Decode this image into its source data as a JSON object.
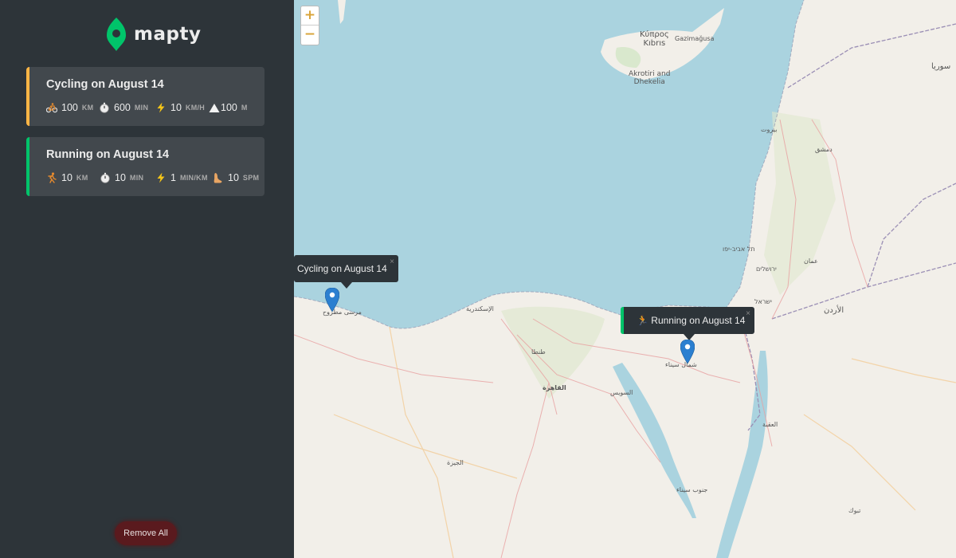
{
  "app": {
    "name": "mapty",
    "brand_color": "#00c46a"
  },
  "workouts": [
    {
      "type": "cycling",
      "title": "Cycling on August 14",
      "accent": "#ffb545",
      "details": [
        {
          "icon": "bicycle-icon",
          "value": "100",
          "unit": "KM"
        },
        {
          "icon": "stopwatch-icon",
          "value": "600",
          "unit": "MIN"
        },
        {
          "icon": "lightning-icon",
          "value": "10",
          "unit": "KM/H"
        },
        {
          "icon": "mountain-icon",
          "value": "100",
          "unit": "M"
        }
      ]
    },
    {
      "type": "running",
      "title": "Running on August 14",
      "accent": "#00c46a",
      "details": [
        {
          "icon": "runner-icon",
          "value": "10",
          "unit": "KM"
        },
        {
          "icon": "stopwatch-icon",
          "value": "10",
          "unit": "MIN"
        },
        {
          "icon": "lightning-icon",
          "value": "1",
          "unit": "MIN/KM"
        },
        {
          "icon": "footprint-icon",
          "value": "10",
          "unit": "SPM"
        }
      ]
    }
  ],
  "remove_all_label": "Remove All",
  "map": {
    "zoom_in": "+",
    "zoom_out": "−",
    "popups": {
      "cycling": "Cycling on August 14",
      "running": "🏃 Running on August 14",
      "close": "×"
    },
    "labels": {
      "cyprus": "Κύπρος\nKıbrıs",
      "gazimagusa": "Gazimağusa",
      "akrotiri": "Akrotiri and\nDhekelia",
      "alexandria": "الإسكندرية",
      "cairo": "القاهرة",
      "tanta": "طنطا",
      "suez": "السويس",
      "sinai": "شمال سيناء",
      "sinai_south": "جنوب سيناء",
      "jordan": "الأردن",
      "amman": "عمان",
      "beirut": "بيروت",
      "damascus": "دمشق",
      "syria": "سوريا",
      "tel_aviv": "תל אביב-יפו",
      "jerusalem": "ירושלים",
      "israel": "ישראל",
      "matruh": "مرسى مطروح",
      "giza": "الجيزة",
      "tabuk": "تبوك",
      "aqaba": "العقبة"
    }
  }
}
